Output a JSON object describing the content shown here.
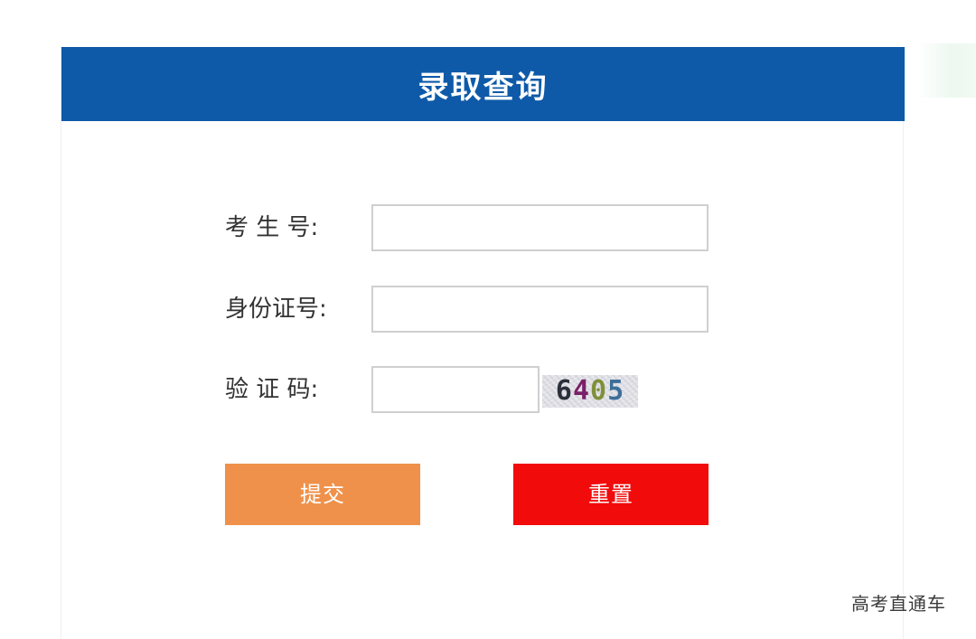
{
  "header": {
    "title": "录取查询"
  },
  "form": {
    "exam_number": {
      "label": "考 生 号:",
      "value": ""
    },
    "id_number": {
      "label": "身份证号:",
      "value": ""
    },
    "captcha": {
      "label": "验 证 码:",
      "value": "",
      "image_digits": [
        "6",
        "4",
        "0",
        "5"
      ],
      "digit_colors": [
        "#2a2f3a",
        "#7a1f6a",
        "#7f8f3a",
        "#3c6f9a"
      ]
    }
  },
  "buttons": {
    "submit_label": "提交",
    "reset_label": "重置"
  },
  "watermark": {
    "text": "高考直通车"
  },
  "colors": {
    "header_bg": "#0e5aa8",
    "submit_bg": "#ef914a",
    "reset_bg": "#f20b0b"
  }
}
